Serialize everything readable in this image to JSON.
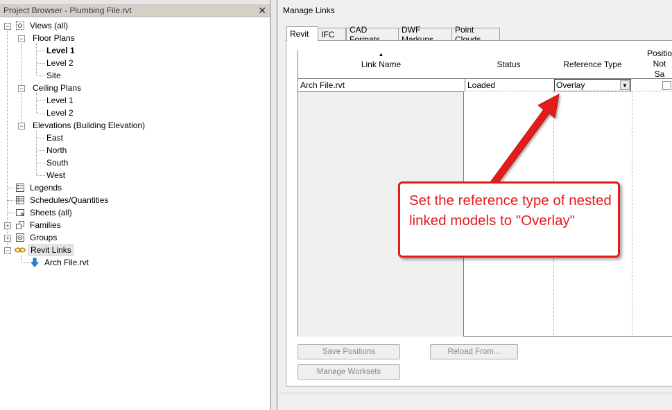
{
  "project_browser": {
    "title": "Project Browser - Plumbing File.rvt",
    "close_glyph": "✕",
    "tree": {
      "views": "Views (all)",
      "floor_plans": "Floor Plans",
      "fp_level1": "Level 1",
      "fp_level2": "Level 2",
      "fp_site": "Site",
      "ceiling_plans": "Ceiling Plans",
      "cp_level1": "Level 1",
      "cp_level2": "Level 2",
      "elevations": "Elevations (Building Elevation)",
      "el_east": "East",
      "el_north": "North",
      "el_south": "South",
      "el_west": "West",
      "legends": "Legends",
      "schedules": "Schedules/Quantities",
      "sheets": "Sheets (all)",
      "families": "Families",
      "groups": "Groups",
      "revit_links": "Revit Links",
      "arch_file": "Arch File.rvt"
    }
  },
  "dialog": {
    "title": "Manage Links",
    "tabs": [
      "Revit",
      "IFC",
      "CAD Formats",
      "DWF Markups",
      "Point Clouds"
    ],
    "active_tab": "Revit",
    "columns": {
      "link_name": "Link Name",
      "status": "Status",
      "reference_type": "Reference Type",
      "positions": "Positio Not Sa"
    },
    "rows": [
      {
        "link_name": "Arch File.rvt",
        "status": "Loaded",
        "reference_type": "Overlay",
        "positions_saved": false
      }
    ],
    "buttons": {
      "save_positions": "Save Positions",
      "reload_from": "Reload From...",
      "manage_worksets": "Manage Worksets"
    }
  },
  "callout": {
    "text": "Set the reference type of nested linked models to \"Overlay\"",
    "color": "#e41b1b"
  }
}
